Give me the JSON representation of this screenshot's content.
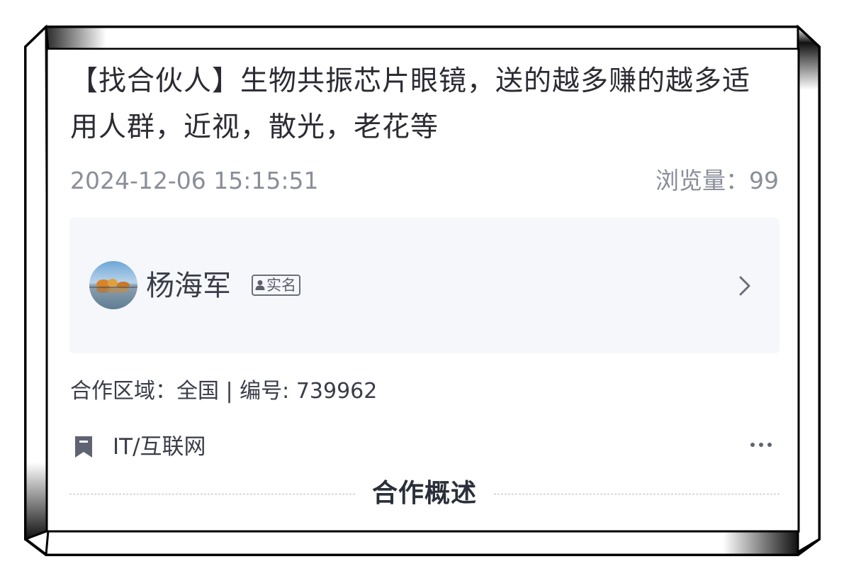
{
  "post": {
    "title": "【找合伙人】生物共振芯片眼镜，送的越多赚的越多适用人群，近视，散光，老花等",
    "date": "2024-12-06 15:15:51",
    "views_label": "浏览量：99"
  },
  "author": {
    "name": "杨海军",
    "verified_label": "实名",
    "chevron_icon": "chevron-right-icon"
  },
  "details": {
    "region_line": "合作区域：全国 | 编号: 739962",
    "category": "IT/互联网",
    "category_icon": "bookmark-icon",
    "more_icon": "more-dots-icon"
  },
  "section": {
    "title": "合作概述"
  },
  "colors": {
    "text_primary": "#2b2b33",
    "text_muted": "#8a8e99",
    "card_bg": "#f6f7fb",
    "frame": "#000000"
  }
}
